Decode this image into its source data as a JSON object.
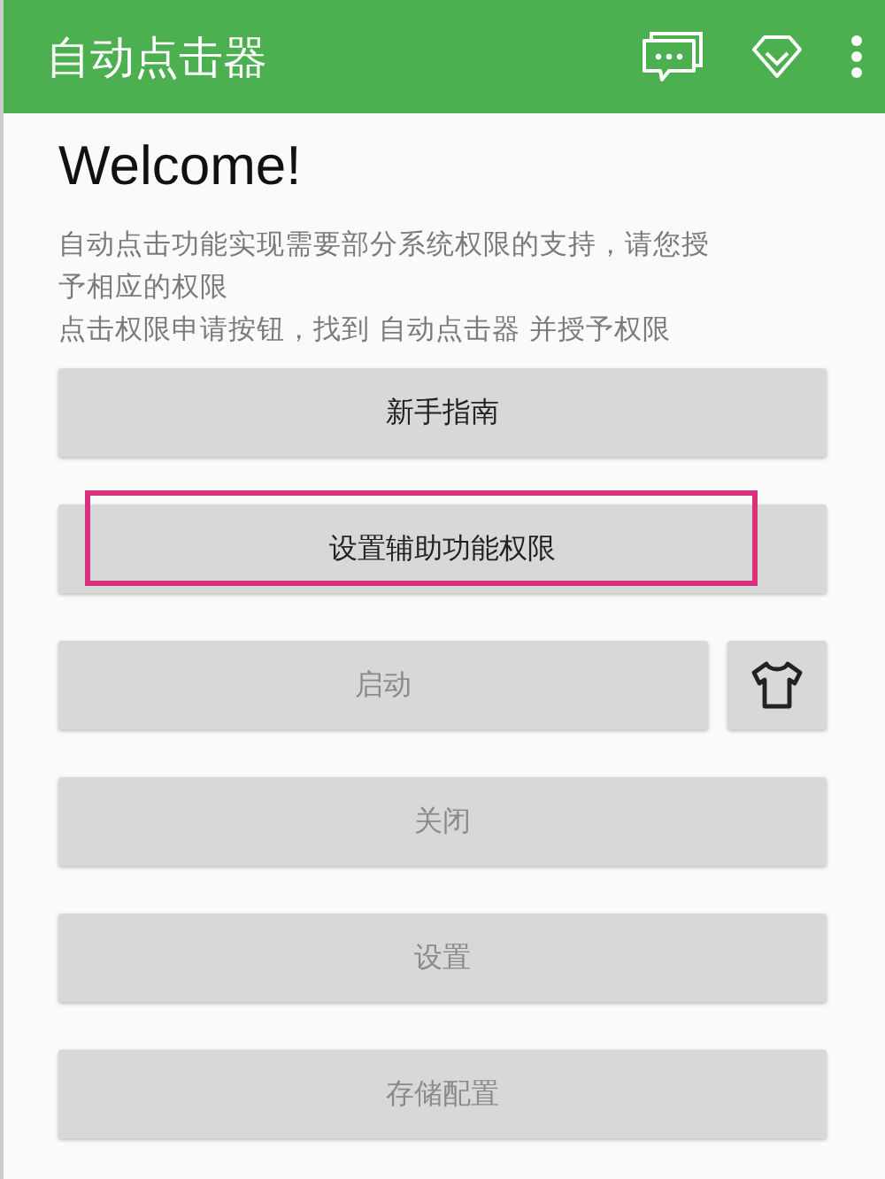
{
  "app_bar": {
    "title": "自动点击器"
  },
  "heading": "Welcome!",
  "description": [
    "自动点击功能实现需要部分系统权限的支持，请您授予相应的权限",
    "点击权限申请按钮，找到 自动点击器 并授予权限"
  ],
  "rows": [
    {
      "buttons": [
        {
          "kind": "text",
          "label": "新手指南",
          "disabled": false,
          "highlighted": false
        }
      ]
    },
    {
      "buttons": [
        {
          "kind": "text",
          "label": "设置辅助功能权限",
          "disabled": false,
          "highlighted": true
        }
      ]
    },
    {
      "buttons": [
        {
          "kind": "text",
          "label": "启动",
          "disabled": true,
          "highlighted": false
        },
        {
          "kind": "icon",
          "disabled": false
        }
      ]
    },
    {
      "buttons": [
        {
          "kind": "text",
          "label": "关闭",
          "disabled": true,
          "highlighted": false
        }
      ]
    },
    {
      "buttons": [
        {
          "kind": "text",
          "label": "设置",
          "disabled": true,
          "highlighted": false
        }
      ]
    },
    {
      "buttons": [
        {
          "kind": "text",
          "label": "存储配置",
          "disabled": true,
          "highlighted": false
        }
      ]
    }
  ]
}
